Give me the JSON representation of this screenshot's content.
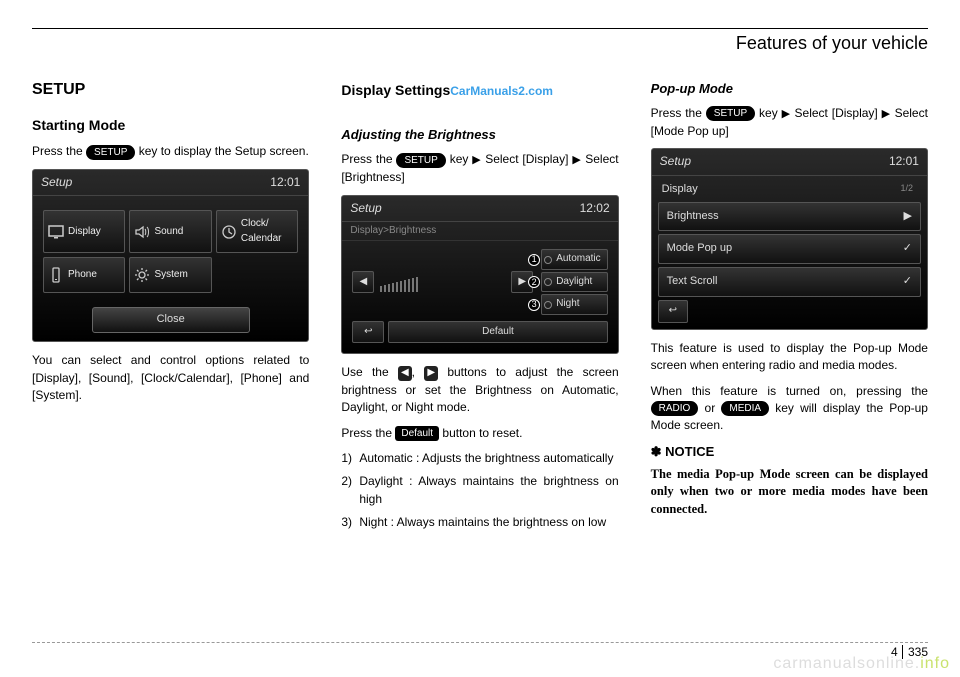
{
  "header": {
    "title": "Features of your vehicle"
  },
  "footer": {
    "section": "4",
    "page": "335"
  },
  "watermark_top": "CarManuals2.com",
  "watermark_bottom_a": "carmanualsonline.",
  "watermark_bottom_b": "info",
  "col1": {
    "h1": "SETUP",
    "h2": "Starting Mode",
    "p1a": "Press the ",
    "key_setup": "SETUP",
    "p1b": " key to display the Setup screen.",
    "p2": "You can select and control options related to [Display], [Sound], [Clock/Calendar], [Phone] and [System].",
    "screen": {
      "title": "Setup",
      "time": "12:01",
      "items": [
        "Display",
        "Sound",
        "Clock/\nCalendar",
        "Phone",
        "System"
      ],
      "close": "Close"
    }
  },
  "col2": {
    "h2": "Display Settings",
    "h3": "Adjusting the Brightness",
    "p1a": "Press the ",
    "key_setup": "SETUP",
    "p1b": " key",
    "p1c": "Select [Display]",
    "p1d": "Select [Brightness]",
    "p2a": "Use the ",
    "p2b": ", ",
    "p2c": " buttons to adjust the screen brightness or set the Brightness on Automatic, Daylight, or Night mode.",
    "p3a": "Press the ",
    "key_default": "Default",
    "p3b": " button to reset.",
    "list": [
      {
        "num": "1)",
        "text": "Automatic : Adjusts the brightness automatically"
      },
      {
        "num": "2)",
        "text": "Daylight : Always maintains the brightness on high"
      },
      {
        "num": "3)",
        "text": "Night : Always maintains the brightness on low"
      }
    ],
    "screen": {
      "title": "Setup",
      "time": "12:02",
      "breadcrumb": "Display>Brightness",
      "options": [
        "Automatic",
        "Daylight",
        "Night"
      ],
      "back_icon": "↩",
      "default": "Default"
    }
  },
  "col3": {
    "h3": "Pop-up Mode",
    "p1a": "Press the ",
    "key_setup": "SETUP",
    "p1b": " key",
    "p1c": "Select [Display]",
    "p1d": "Select [Mode Pop up]",
    "p2": "This feature is used to display the Pop-up Mode screen when entering radio and media modes.",
    "p3a": "When this feature is turned on, pressing the ",
    "key_radio": "RADIO",
    "p3b": " or ",
    "key_media": "MEDIA",
    "p3c": " key will display the Pop-up Mode screen.",
    "notice_head": "✽ NOTICE",
    "notice_body": "The media Pop-up Mode screen can be displayed only when two or more media modes have been connected.",
    "screen": {
      "title": "Setup",
      "time": "12:01",
      "heading": "Display",
      "page_indicator": "1/2",
      "rows": [
        {
          "label": "Brightness",
          "right": "▶"
        },
        {
          "label": "Mode Pop up",
          "right": "✓"
        },
        {
          "label": "Text Scroll",
          "right": "✓"
        }
      ],
      "back_icon": "↩"
    }
  }
}
